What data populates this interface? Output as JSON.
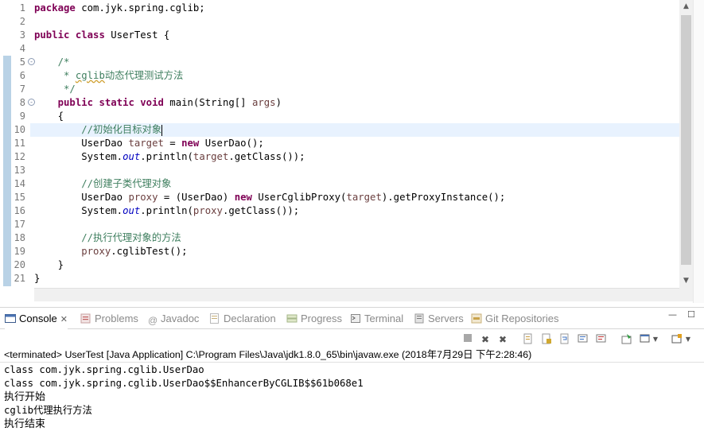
{
  "editor": {
    "line_numbers": [
      "1",
      "2",
      "3",
      "4",
      "5",
      "6",
      "7",
      "8",
      "9",
      "10",
      "11",
      "12",
      "13",
      "14",
      "15",
      "16",
      "17",
      "18",
      "19",
      "20",
      "21"
    ],
    "folds": {
      "5": "-",
      "8": "-"
    },
    "current_line": 10
  },
  "code": {
    "l1_kw": "package",
    "l1_rest": " com.jyk.spring.cglib;",
    "l3_kw1": "public",
    "l3_kw2": "class",
    "l3_rest": " UserTest {",
    "l5": "    /*",
    "l6_a": "     * ",
    "l6_b": "cglib",
    "l6_c": "动态代理测试方法",
    "l7": "     */",
    "l8_kw1": "public",
    "l8_kw2": "static",
    "l8_kw3": "void",
    "l8_a": " main(String[] ",
    "l8_var": "args",
    "l8_b": ")",
    "l9": "    {",
    "l10": "        //初始化目标对象",
    "l11_a": "        UserDao ",
    "l11_var": "target",
    "l11_b": " = ",
    "l11_kw": "new",
    "l11_c": " UserDao();",
    "l12_a": "        System.",
    "l12_fld": "out",
    "l12_b": ".println(",
    "l12_var": "target",
    "l12_c": ".getClass());",
    "l14": "        //创建子类代理对象",
    "l15_a": "        UserDao ",
    "l15_var": "proxy",
    "l15_b": " = (UserDao) ",
    "l15_kw": "new",
    "l15_c": " UserCglibProxy(",
    "l15_var2": "target",
    "l15_d": ").getProxyInstance();",
    "l16_a": "        System.",
    "l16_fld": "out",
    "l16_b": ".println(",
    "l16_var": "proxy",
    "l16_c": ".getClass());",
    "l18": "        //执行代理对象的方法",
    "l19_a": "        ",
    "l19_var": "proxy",
    "l19_b": ".cglibTest();",
    "l20": "    }",
    "l21": "}"
  },
  "scrollbar": {
    "up": "▲",
    "down": "▼"
  },
  "views": {
    "tabs": [
      {
        "label": "Console",
        "icon": "console-icon"
      },
      {
        "label": "Problems",
        "icon": "problems-icon"
      },
      {
        "label": "Javadoc",
        "icon": "javadoc-icon"
      },
      {
        "label": "Declaration",
        "icon": "declaration-icon"
      },
      {
        "label": "Progress",
        "icon": "progress-icon"
      },
      {
        "label": "Terminal",
        "icon": "terminal-icon"
      },
      {
        "label": "Servers",
        "icon": "servers-icon"
      },
      {
        "label": "Git Repositories",
        "icon": "git-icon"
      }
    ],
    "close_glyph": "✕",
    "minimize": "—",
    "maximize": "☐"
  },
  "console": {
    "status": "<terminated> UserTest [Java Application] C:\\Program Files\\Java\\jdk1.8.0_65\\bin\\javaw.exe (2018年7月29日 下午2:28:46)",
    "output": [
      "class com.jyk.spring.cglib.UserDao",
      "class com.jyk.spring.cglib.UserDao$$EnhancerByCGLIB$$61b068e1",
      "执行开始",
      "cglib代理执行方法",
      "执行结束"
    ]
  },
  "colors": {
    "keyword": "#7f0055",
    "comment": "#3f7f5f",
    "field": "#0000c0",
    "local_var": "#6a3e3e",
    "current_line": "#e8f2fe"
  }
}
